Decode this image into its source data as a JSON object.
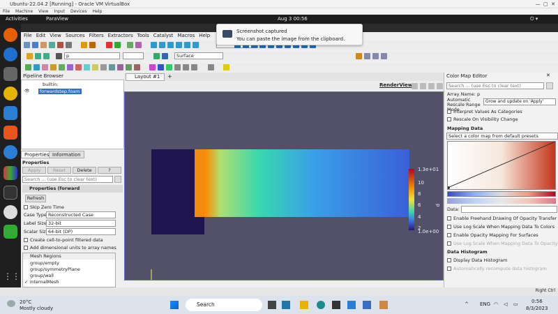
{
  "vbox": {
    "title": "Ubuntu-22.04.2 [Running] - Oracle VM VirtualBox",
    "menu": [
      "File",
      "Machine",
      "View",
      "Input",
      "Devices",
      "Help"
    ]
  },
  "gnome": {
    "activities": "Activities",
    "app": "ParaView",
    "clock": "Aug 3  00:56"
  },
  "notification": {
    "title": "Screenshot captured",
    "body": "You can paste the image from the clipboard."
  },
  "paraview": {
    "menu": [
      "File",
      "Edit",
      "View",
      "Sources",
      "Filters",
      "Extractors",
      "Tools",
      "Catalyst",
      "Macros",
      "Help"
    ],
    "toolbar": {
      "color_by": "p",
      "representation": "Surface"
    },
    "pipeline": {
      "title": "Pipeline Browser",
      "items": [
        "builtin:",
        "forwardstep.foam"
      ]
    },
    "layout_tab": "Layout #1",
    "render_view_label": "RenderView1",
    "props": {
      "tabs": [
        "Properties",
        "Information"
      ],
      "section": "Properties",
      "buttons": [
        "Apply",
        "Reset",
        "Delete",
        "?"
      ],
      "search_placeholder": "Search ... (use Esc to clear text)",
      "group": "Properties (forward",
      "refresh": "Refresh",
      "skip_zero": "Skip Zero Time",
      "case_type_label": "Case Type",
      "case_type": "Reconstructed Case",
      "label_size_label": "Label Size",
      "label_size": "32-bit",
      "scalar_size_label": "Scalar Size",
      "scalar_size": "64-bit (DP)",
      "cell_to_point": "Create cell-to-point filtered data",
      "dim_units": "Add dimensional units to array names",
      "mesh_header": "Mesh Regions",
      "mesh": [
        "group/empty",
        "group/symmetryPlane",
        "group/wall",
        "internalMesh"
      ]
    },
    "colorbar": {
      "max": "1.3e+01",
      "t10": "10",
      "t8": "8",
      "t6": "6",
      "t4": "4",
      "t2": "2",
      "min": "1.0e+00",
      "title": "p"
    },
    "cme": {
      "title": "Color Map Editor",
      "search_placeholder": "Search ... (use Esc to clear text)",
      "array_name": "Array Name: p",
      "auto_rescale_label": "Automatic Rescale Range Mode",
      "auto_rescale": "Grow and update on 'Apply'",
      "interp": "Interpret Values As Categories",
      "rescale_vis": "Rescale On Visibility Change",
      "mapping": "Mapping Data",
      "preset": "Select a color map from default presets",
      "data_label": "Data:",
      "freehand": "Enable Freehand Drawing Of Opacity Transfer Fun",
      "log_colors": "Use Log Scale When Mapping Data To Colors",
      "opacity_surf": "Enable Opacity Mapping For Surfaces",
      "log_opacity": "Use Log Scale When Mapping Data To Opacity",
      "histogram": "Data Histogram",
      "display_hist": "Display Data Histogram",
      "auto_hist": "Automatically recompute data histogram"
    }
  },
  "taskbar": {
    "weather_temp": "20°C",
    "weather_desc": "Mostly cloudy",
    "search": "Search",
    "lang": "ENG",
    "time": "0:56",
    "date": "8/3/2023"
  },
  "vbox_status": {
    "host_key": "Right Ctrl"
  }
}
